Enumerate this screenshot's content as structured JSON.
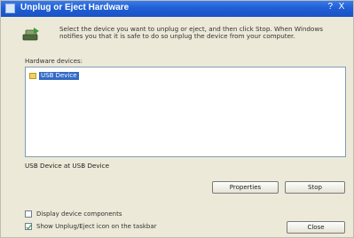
{
  "window": {
    "title": "Unplug or Eject Hardware",
    "buttons": [
      "?",
      "X"
    ]
  },
  "intro_text": "Select the device you want to unplug or eject, and then click Stop. When Windows notifies you that it is safe to do so unplug the device from your computer.",
  "list": {
    "label": "Hardware devices:",
    "items": [
      {
        "label": "USB Device",
        "selected": true
      }
    ]
  },
  "status_text": "USB Device at USB Device",
  "buttons": {
    "properties": "Properties",
    "stop": "Stop",
    "close": "Close"
  },
  "options": [
    {
      "label": "Display device components",
      "checked": false
    },
    {
      "label": "Show Unplug/Eject icon on the taskbar",
      "checked": true
    }
  ],
  "colors": {
    "titlebar": "#1f5fd6",
    "selection": "#316ac5",
    "dialog_bg": "#ece9d8"
  }
}
